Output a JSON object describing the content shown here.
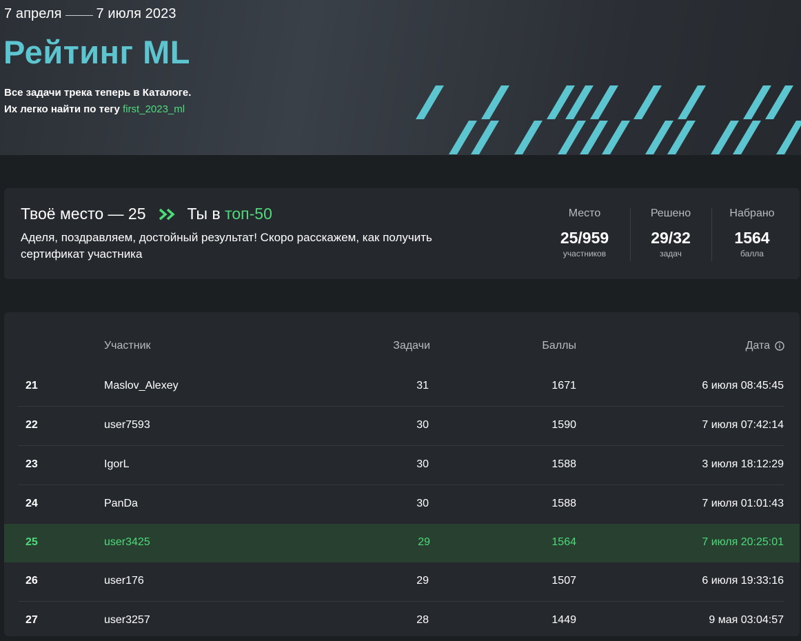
{
  "hero": {
    "date_start": "7 апреля",
    "date_end": "7 июля 2023",
    "title": "Рейтинг ML",
    "desc_line1": "Все задачи трека теперь в Каталоге.",
    "desc_line2": "Их легко найти по тегу",
    "tag": "first_2023_ml"
  },
  "rank_card": {
    "title_place": "Твоё место — 25",
    "title_in": "Ты в",
    "title_top": "топ-50",
    "message": "Аделя, поздравляем, достойный результат! Скоро расскажем, как получить сертификат участника",
    "stats": [
      {
        "label": "Место",
        "value": "25/959",
        "sub": "участников"
      },
      {
        "label": "Решено",
        "value": "29/32",
        "sub": "задач"
      },
      {
        "label": "Набрано",
        "value": "1564",
        "sub": "балла"
      }
    ]
  },
  "table": {
    "headers": {
      "name": "Участник",
      "tasks": "Задачи",
      "score": "Баллы",
      "date": "Дата"
    },
    "rows": [
      {
        "rank": "21",
        "name": "Maslov_Alexey",
        "tasks": "31",
        "score": "1671",
        "date": "6 июля 08:45:45"
      },
      {
        "rank": "22",
        "name": "user7593",
        "tasks": "30",
        "score": "1590",
        "date": "7 июля 07:42:14"
      },
      {
        "rank": "23",
        "name": "IgorL",
        "tasks": "30",
        "score": "1588",
        "date": "3 июля 18:12:29"
      },
      {
        "rank": "24",
        "name": "PanDa",
        "tasks": "30",
        "score": "1588",
        "date": "7 июля 01:01:43"
      },
      {
        "rank": "25",
        "name": "user3425",
        "tasks": "29",
        "score": "1564",
        "date": "7 июля 20:25:01"
      },
      {
        "rank": "26",
        "name": "user176",
        "tasks": "29",
        "score": "1507",
        "date": "6 июля 19:33:16"
      },
      {
        "rank": "27",
        "name": "user3257",
        "tasks": "28",
        "score": "1449",
        "date": "9 мая 03:04:57"
      }
    ]
  },
  "colors": {
    "accent_teal": "#5cc5cf",
    "accent_green": "#4ddb7a",
    "highlight_row": "#27402f"
  }
}
